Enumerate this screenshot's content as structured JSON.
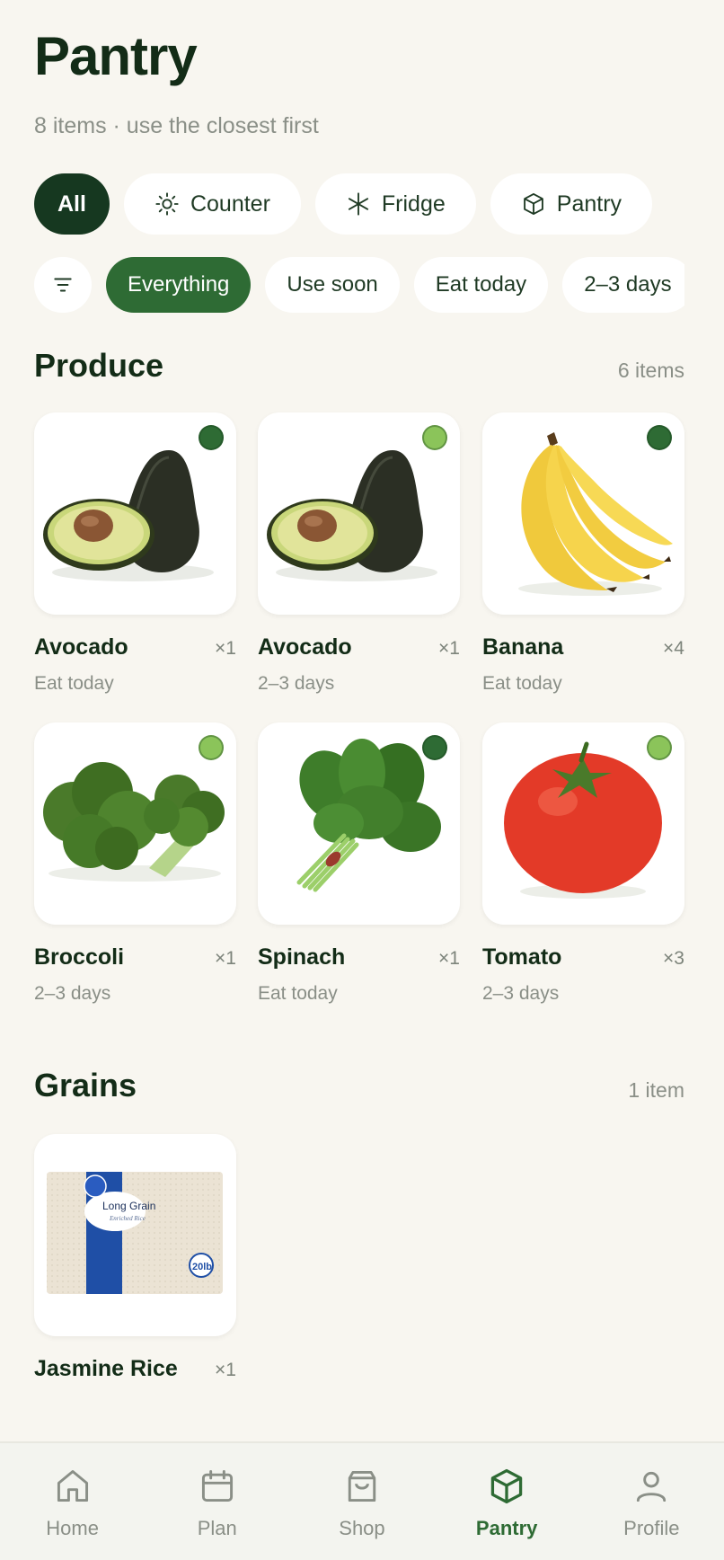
{
  "header": {
    "title": "Pantry",
    "subtitle": "8 items · use the closest first"
  },
  "locations": [
    {
      "label": "All",
      "icon": "none",
      "active": true
    },
    {
      "label": "Counter",
      "icon": "sun-icon",
      "active": false
    },
    {
      "label": "Fridge",
      "icon": "snowflake-icon",
      "active": false
    },
    {
      "label": "Pantry",
      "icon": "box-icon",
      "active": false
    }
  ],
  "freshness": [
    {
      "label": "Everything",
      "active": true
    },
    {
      "label": "Use soon",
      "active": false
    },
    {
      "label": "Eat today",
      "active": false
    },
    {
      "label": "2–3 days",
      "active": false
    }
  ],
  "produce": {
    "title": "Produce",
    "count": "6 items",
    "items": [
      {
        "name": "Avocado",
        "qty": "×1",
        "status": "Eat today",
        "dot": "#2e6b34",
        "icon": "avocado-icon"
      },
      {
        "name": "Avocado",
        "qty": "×1",
        "status": "2–3 days",
        "dot": "#8bc45a",
        "icon": "avocado-icon"
      },
      {
        "name": "Banana",
        "qty": "×4",
        "status": "Eat today",
        "dot": "#2e6b34",
        "icon": "banana-icon"
      },
      {
        "name": "Broccoli",
        "qty": "×1",
        "status": "2–3 days",
        "dot": "#8bc45a",
        "icon": "broccoli-icon"
      },
      {
        "name": "Spinach",
        "qty": "×1",
        "status": "Eat today",
        "dot": "#2e6b34",
        "icon": "spinach-icon"
      },
      {
        "name": "Tomato",
        "qty": "×3",
        "status": "2–3 days",
        "dot": "#8bc45a",
        "icon": "tomato-icon"
      }
    ]
  },
  "grains": {
    "title": "Grains",
    "count": "1 item",
    "items": [
      {
        "name": "Jasmine Rice",
        "qty": "×1",
        "icon": "rice-bag-icon",
        "bag_text": "Long Grain",
        "bag_subtext": "Enriched Rice",
        "bag_size": "20lb"
      }
    ]
  },
  "nav": [
    {
      "label": "Home",
      "icon": "home-icon",
      "active": false
    },
    {
      "label": "Plan",
      "icon": "calendar-icon",
      "active": false
    },
    {
      "label": "Shop",
      "icon": "shopping-bag-icon",
      "active": false
    },
    {
      "label": "Pantry",
      "icon": "box-icon",
      "active": true
    },
    {
      "label": "Profile",
      "icon": "person-icon",
      "active": false
    }
  ],
  "colors": {
    "accent": "#2e6b34",
    "dark": "#163820",
    "background": "#f8f6f0"
  }
}
